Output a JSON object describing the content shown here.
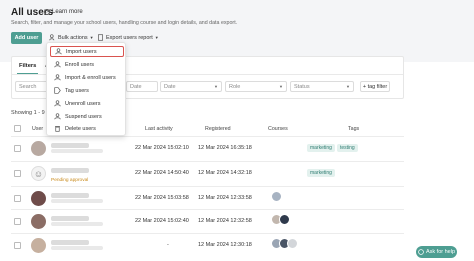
{
  "header": {
    "title": "All users",
    "learn_more": "Learn more",
    "subtitle": "Search, filter, and manage your school users, handling course and login details, and data export."
  },
  "toolbar": {
    "add_user": "Add user",
    "bulk_actions": "Bulk actions",
    "export": "Export users report"
  },
  "bulk_menu": {
    "items": [
      "Import users",
      "Enroll users",
      "Import & enroll users",
      "Tag users",
      "Unenroll users",
      "Suspend users",
      "Delete users"
    ]
  },
  "tabs": {
    "filters": "Filters",
    "second": "A"
  },
  "filters": {
    "search": "Search",
    "date_1": "Date",
    "date_2": "Date",
    "role": "Role",
    "status": "Status",
    "tag_filter": "+ tag filter"
  },
  "showing": "Showing 1 - 9 u",
  "table": {
    "headers": {
      "user": "User",
      "last_activity": "Last activity",
      "registered": "Registered",
      "courses": "Courses",
      "tags": "Tags"
    },
    "rows": [
      {
        "last_activity": "22 Mar 2024 15:02:10",
        "registered": "12 Mar 2024 16:35:18",
        "tags": [
          "marketing",
          "testing"
        ],
        "pending": "",
        "courses": 0
      },
      {
        "last_activity": "22 Mar 2024 14:50:40",
        "registered": "12 Mar 2024 14:32:18",
        "tags": [
          "marketing"
        ],
        "pending": "Pending approval",
        "courses": 0
      },
      {
        "last_activity": "22 Mar 2024 15:03:58",
        "registered": "12 Mar 2024 12:33:58",
        "tags": [],
        "pending": "",
        "courses": 1
      },
      {
        "last_activity": "22 Mar 2024 15:02:40",
        "registered": "12 Mar 2024 12:32:58",
        "tags": [],
        "pending": "",
        "courses": 2
      },
      {
        "last_activity": "-",
        "registered": "12 Mar 2024 12:30:18",
        "tags": [],
        "pending": "",
        "courses": 3
      }
    ]
  },
  "help": {
    "label": "Ask for help"
  },
  "colors": {
    "accent": "#4e9e92",
    "menu_highlight": "#d9534f"
  }
}
